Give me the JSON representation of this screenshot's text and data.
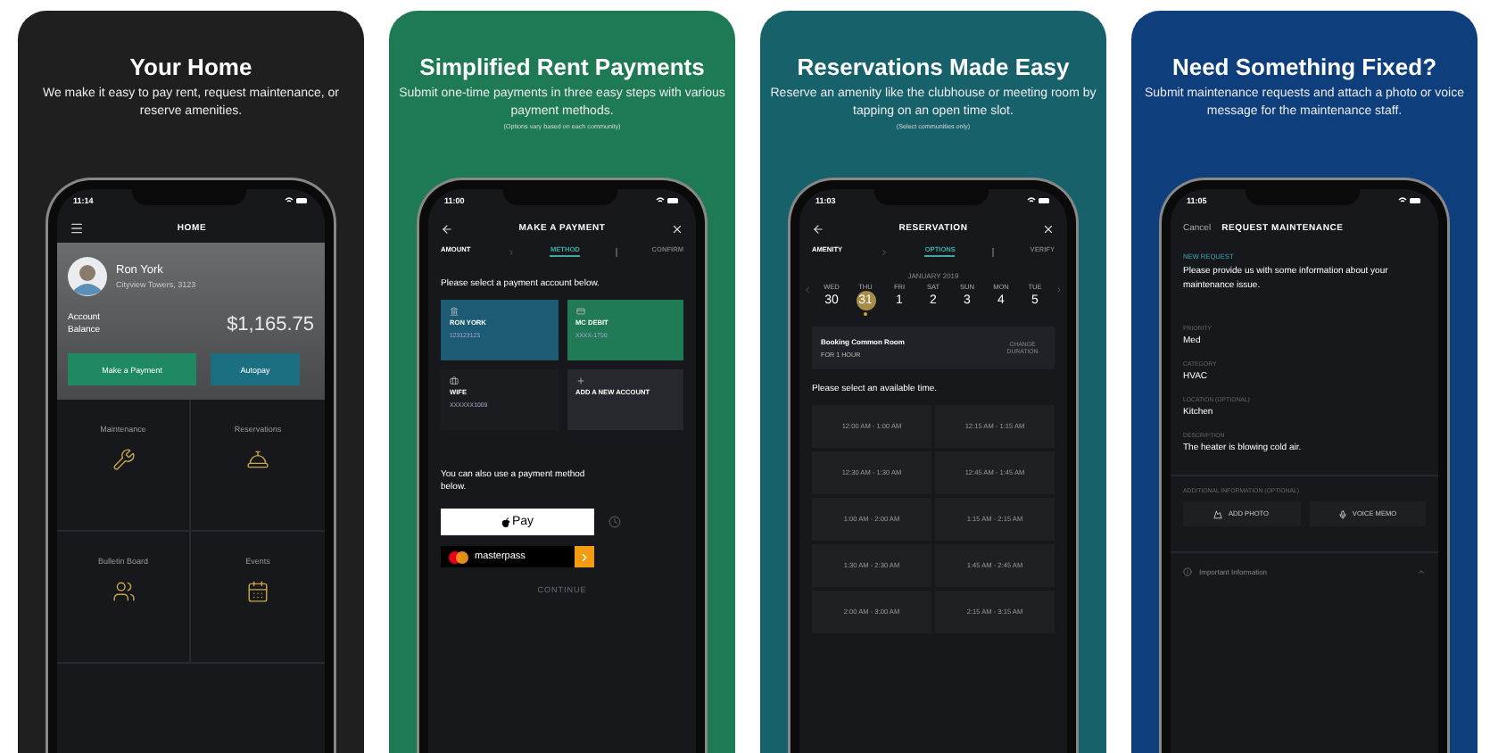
{
  "panels": [
    {
      "kind": "home",
      "color": "#1f1f1f",
      "title": "Your Home",
      "subtitle": "We make it easy to pay rent, request maintenance, or reserve amenities.",
      "screen": {
        "time": "11:14",
        "header": "HOME",
        "resident": {
          "name": "Ron York",
          "address": "Cityview Towers, 3123"
        },
        "balance_label": "Account Balance",
        "balance": "$1,165.75",
        "buttons": [
          "Make a Payment",
          "Autopay"
        ],
        "tiles": [
          "Maintenance",
          "Reservations",
          "Bulletin Board",
          "Events"
        ]
      }
    },
    {
      "kind": "payment",
      "color": "#1e7a55",
      "title": "Simplified Rent Payments",
      "subtitle": "Submit one-time payments in three easy steps with various payment methods.",
      "note": "(Options vary based on each community)",
      "screen": {
        "time": "11:00",
        "header": "MAKE A PAYMENT",
        "steps": [
          {
            "label": "AMOUNT",
            "selected": false
          },
          {
            "label": "METHOD",
            "selected": true
          },
          {
            "label": "CONFIRM",
            "selected": false
          }
        ],
        "prompt": "Please select a payment account below.",
        "accounts": [
          {
            "name": "RON YORK",
            "detail": "123123123",
            "color": "#1d5a73"
          },
          {
            "name": "MC DEBIT",
            "detail": "XXXX-1750",
            "color": "#1f7a55"
          },
          {
            "name": "WIFE",
            "detail": "XXXXXX1009",
            "color": "#1a1c1f"
          },
          {
            "name": "ADD A NEW ACCOUNT",
            "color": "#25282c"
          }
        ],
        "alt_prompt": "You can also use a payment method below.",
        "apple_pay": "Pay",
        "masterpass": "masterpass",
        "continue": "CONTINUE"
      }
    },
    {
      "kind": "reservation",
      "color": "#17616b",
      "title": "Reservations Made Easy",
      "subtitle": "Reserve an amenity like the clubhouse or meeting room by tapping on an open time slot.",
      "note": "(Select communities only)",
      "screen": {
        "time": "11:03",
        "header": "RESERVATION",
        "steps": [
          {
            "label": "AMENITY",
            "selected": false
          },
          {
            "label": "OPTIONS",
            "selected": true
          },
          {
            "label": "VERIFY",
            "selected": false
          }
        ],
        "month": "JANUARY 2019",
        "days": [
          {
            "weekday": "WED",
            "day": "30",
            "selected": false
          },
          {
            "weekday": "THU",
            "day": "31",
            "selected": true
          },
          {
            "weekday": "FRI",
            "day": "1",
            "selected": false
          },
          {
            "weekday": "SAT",
            "day": "2",
            "selected": false
          },
          {
            "weekday": "SUN",
            "day": "3",
            "selected": false
          },
          {
            "weekday": "MON",
            "day": "4",
            "selected": false
          },
          {
            "weekday": "TUE",
            "day": "5",
            "selected": false
          }
        ],
        "booking": {
          "title": "Booking Common Room",
          "duration": "FOR 1 HOUR",
          "action": "CHANGE DURATION"
        },
        "prompt": "Please select an available time.",
        "slots": [
          "12:00 AM - 1:00 AM",
          "12:15 AM - 1:15 AM",
          "12:30 AM - 1:30 AM",
          "12:45 AM - 1:45 AM",
          "1:00 AM - 2:00 AM",
          "1:15 AM - 2:15 AM",
          "1:30 AM - 2:30 AM",
          "1:45 AM - 2:45 AM",
          "2:00 AM - 3:00 AM",
          "2:15 AM - 3:15 AM"
        ]
      }
    },
    {
      "kind": "maintenance",
      "color": "#0e3f7c",
      "title": "Need Something Fixed?",
      "subtitle": "Submit maintenance requests and attach a photo or voice message for the maintenance staff.",
      "screen": {
        "time": "11:05",
        "cancel": "Cancel",
        "header": "REQUEST MAINTENANCE",
        "section": "NEW REQUEST",
        "intro": "Please provide us with some information about your maintenance issue.",
        "fields": [
          {
            "label": "PRIORITY",
            "value": "Med"
          },
          {
            "label": "CATEGORY",
            "value": "HVAC"
          },
          {
            "label": "LOCATION (OPTIONAL)",
            "value": "Kitchen"
          },
          {
            "label": "DESCRIPTION",
            "value": "The heater is blowing cold air."
          }
        ],
        "additional": "ADDITIONAL INFORMATION (OPTIONAL)",
        "buttons": [
          "ADD PHOTO",
          "VOICE MEMO"
        ],
        "info": "Important Information"
      }
    }
  ]
}
